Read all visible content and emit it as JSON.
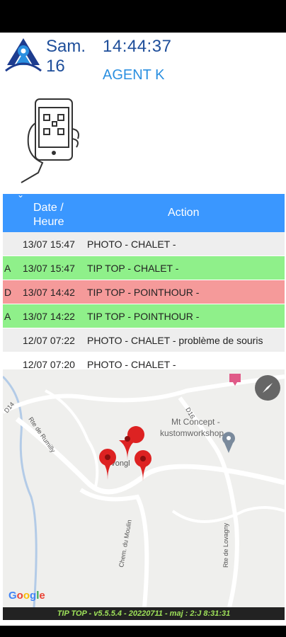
{
  "header": {
    "date": "Sam.\n16",
    "time": "14:44:37",
    "agent": "AGENT K"
  },
  "table": {
    "columns": [
      "Date /\nHeure",
      "Action"
    ],
    "rows": [
      {
        "flag": "",
        "datetime": "13/07 15:47",
        "action": "PHOTO - CHALET -",
        "color": "#eeeeee"
      },
      {
        "flag": "A",
        "datetime": "13/07 15:47",
        "action": "TIP TOP - CHALET -",
        "color": "#8ff08a"
      },
      {
        "flag": "D",
        "datetime": "13/07 14:42",
        "action": "TIP TOP - POINTHOUR -",
        "color": "#f59a9a"
      },
      {
        "flag": "A",
        "datetime": "13/07 14:22",
        "action": "TIP TOP - POINTHOUR -",
        "color": "#8ff08a"
      },
      {
        "flag": "",
        "datetime": "12/07 07:22",
        "action": "PHOTO - CHALET - problème de souris",
        "color": "#eeeeee"
      },
      {
        "flag": "",
        "datetime": "12/07 07:20",
        "action": "PHOTO - CHALET -",
        "color": "#ffffff"
      }
    ]
  },
  "map": {
    "labels": {
      "d14": "D14",
      "rte_rumilly": "Rte de Rumilly",
      "d16": "D16",
      "mt_concept": "Mt Concept -",
      "kustom": "kustomworkshop",
      "chem_moulin": "Chem. du Moulin",
      "rte_lovagny": "Rte de Lovagny",
      "place": "Vongl",
      "google": "Google"
    }
  },
  "footer": {
    "text": "TIP TOP - v5.5.5.4 - 20220711 - maj : 2:J  8:31:31"
  }
}
